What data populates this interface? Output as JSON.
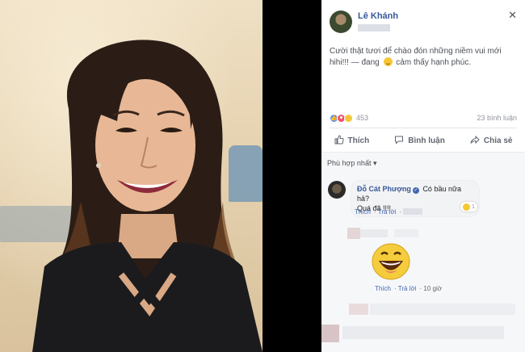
{
  "post": {
    "author": "Lê Khánh",
    "text": "Cười thật tươi để chào đón những niềm vui mới hihi!!! — đang",
    "feeling": "cảm thấy hạnh phúc.",
    "reaction_count": "453",
    "comment_count": "23 bình luận",
    "close_glyph": "✕"
  },
  "actions": {
    "like": "Thích",
    "comment": "Bình luận",
    "share": "Chia sẻ"
  },
  "sort_label": "Phù hợp nhất ▾",
  "comments": [
    {
      "name": "Đỗ Cát Phượng",
      "text_line1": "Có bầu nữa hả?",
      "text_line2": "Quá đã !!!!",
      "like": "Thích",
      "reply": "Trả lời",
      "reaction_count": "1"
    },
    {
      "like": "Thích",
      "reply": "Trả lời",
      "time": "10 giờ"
    }
  ],
  "colors": {
    "link": "#365899",
    "action_text": "#616770",
    "like_blue": "#5890ff",
    "love_red": "#f25268",
    "haha_yellow": "#f7c638"
  },
  "icons": {
    "like": "thumbs-up-icon",
    "comment": "comment-bubble-icon",
    "share": "share-arrow-icon",
    "close": "close-icon",
    "verified": "verified-badge-icon"
  }
}
